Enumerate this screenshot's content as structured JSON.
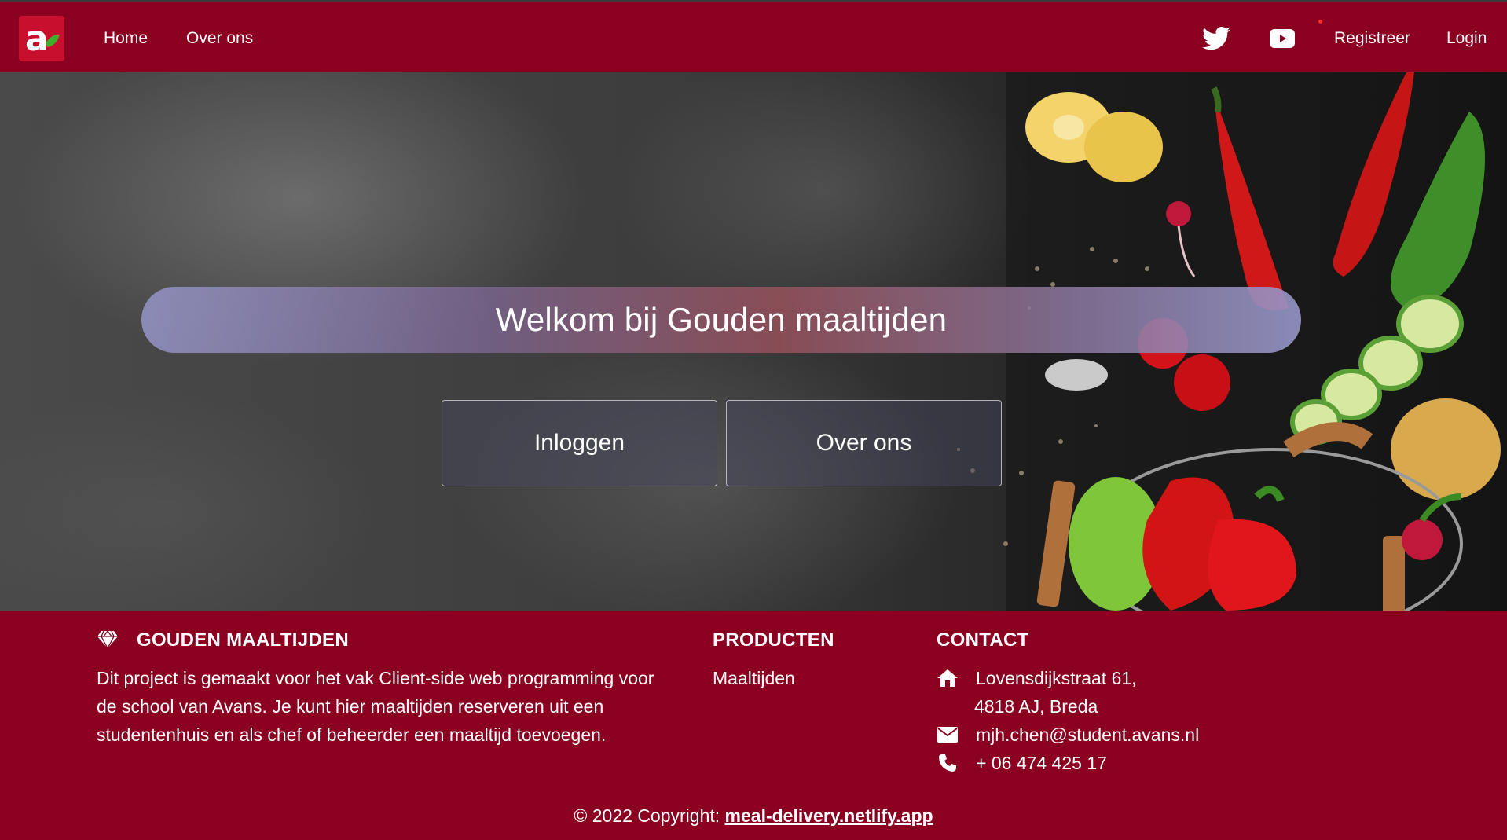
{
  "nav": {
    "logo_icon": "avans-logo-icon",
    "home_label": "Home",
    "over_label": "Over ons",
    "twitter_icon": "twitter-icon",
    "youtube_icon": "youtube-icon",
    "registreer_label": "Registreer",
    "login_label": "Login",
    "background": "#8b0020"
  },
  "hero": {
    "title": "Welkom bij Gouden maaltijden",
    "buttons": [
      {
        "label": "Inloggen"
      },
      {
        "label": "Over ons"
      }
    ]
  },
  "footer": {
    "brand_heading": "GOUDEN MAALTIJDEN",
    "brand_icon": "gem-icon",
    "brand_text": "Dit project is gemaakt voor het vak Client-side web programming voor de school van Avans. Je kunt hier maaltijden reserveren uit een studentenhuis en als chef of beheerder een maaltijd toevoegen.",
    "products_heading": "PRODUCTEN",
    "products_link": "Maaltijden",
    "contact_heading": "CONTACT",
    "address_line1": "Lovensdijkstraat 61,",
    "address_line2": "4818 AJ, Breda",
    "email": "mjh.chen@student.avans.nl",
    "phone": "+ 06 474 425 17",
    "copyright_prefix": "© 2022 Copyright: ",
    "copyright_link": "meal-delivery.netlify.app",
    "background": "#8b0020"
  }
}
